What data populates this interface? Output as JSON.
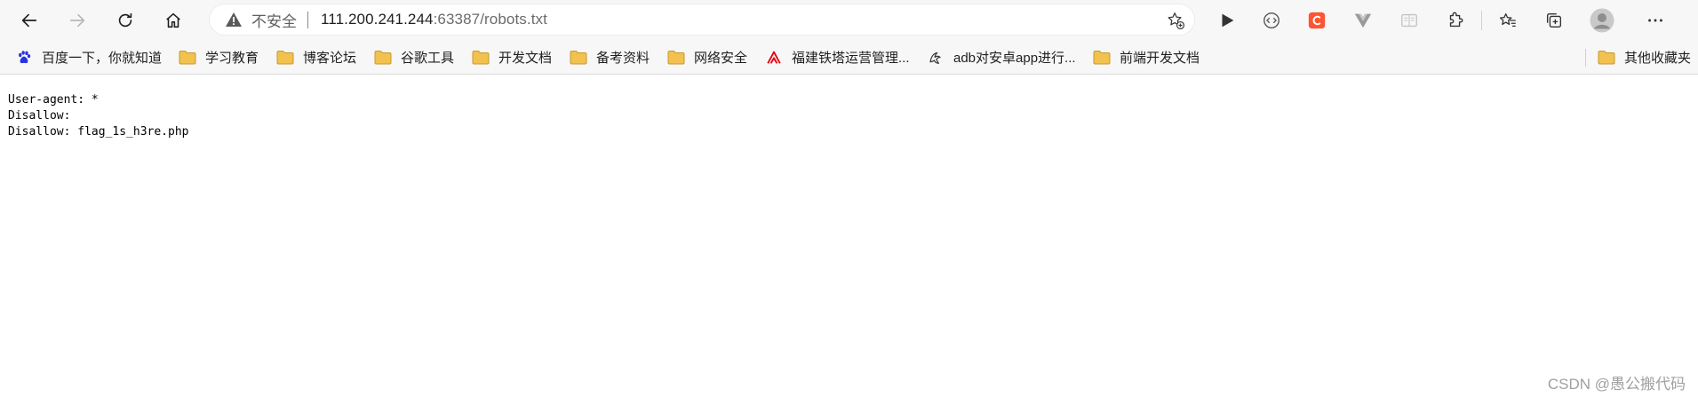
{
  "address_bar": {
    "security_label": "不安全",
    "url_host": "111.200.241.244",
    "url_port": ":63387",
    "url_path": "/robots.txt"
  },
  "icons": {
    "back": "back-arrow-icon",
    "forward": "forward-arrow-icon",
    "reload": "reload-icon",
    "home": "home-icon",
    "warning": "warning-triangle-icon",
    "favorite_add": "star-plus-icon",
    "extensions": [
      "play-icon",
      "code-circle-icon",
      "csdn-c-icon",
      "vue-v-icon",
      "reader-icon",
      "puzzle-extensions-icon"
    ],
    "favorites": "favorites-star-icon",
    "collections": "collections-icon",
    "profile": "profile-avatar-icon",
    "menu": "more-dots-icon"
  },
  "bookmarks": [
    {
      "label": "百度一下，你就知道",
      "icon": "baidu-paw-icon"
    },
    {
      "label": "学习教育",
      "icon": "folder-icon"
    },
    {
      "label": "博客论坛",
      "icon": "folder-icon"
    },
    {
      "label": "谷歌工具",
      "icon": "folder-icon"
    },
    {
      "label": "开发文档",
      "icon": "folder-icon"
    },
    {
      "label": "备考资料",
      "icon": "folder-icon"
    },
    {
      "label": "网络安全",
      "icon": "folder-icon"
    },
    {
      "label": "福建铁塔运营管理...",
      "icon": "tower-logo-icon"
    },
    {
      "label": "adb对安卓app进行...",
      "icon": "wolf-logo-icon"
    },
    {
      "label": "前端开发文档",
      "icon": "folder-icon"
    }
  ],
  "other_bookmarks_label": "其他收藏夹",
  "page_content": {
    "line1": "User-agent: *",
    "line2": "Disallow:",
    "line3": "Disallow: flag_1s_h3re.php"
  },
  "watermark": "CSDN @愚公搬代码",
  "colors": {
    "chrome_bg": "#f7f7f7",
    "folder": "#f2c14e",
    "csdn": "#fc5531",
    "tower_red": "#e60012"
  }
}
